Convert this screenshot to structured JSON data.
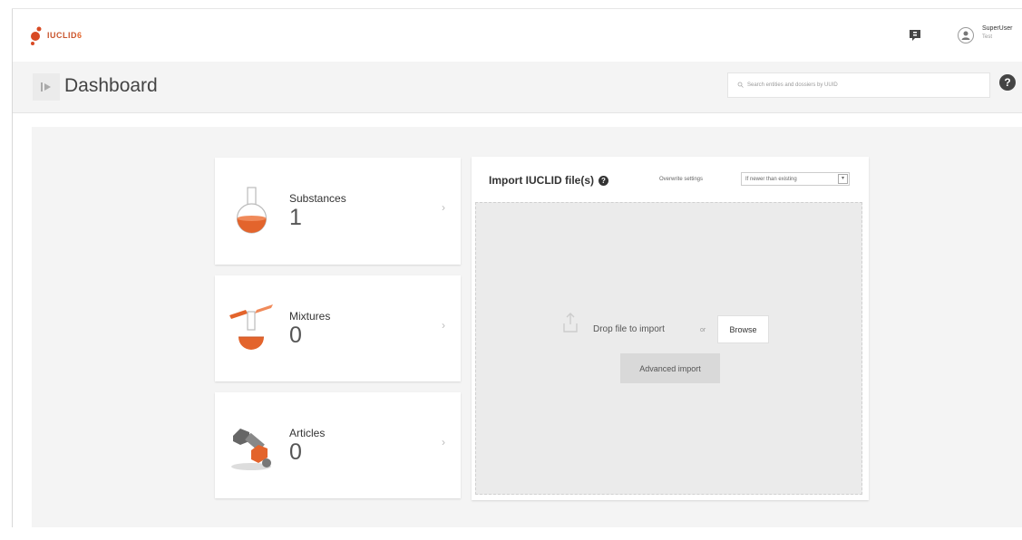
{
  "app": {
    "logo_text": "IUCLID",
    "logo_version": "6"
  },
  "header": {
    "user_name": "SuperUser",
    "user_role": "Test"
  },
  "page": {
    "title": "Dashboard",
    "search_placeholder": "Search entities and dossiers by UUID"
  },
  "cards": [
    {
      "label": "Substances",
      "count": "1"
    },
    {
      "label": "Mixtures",
      "count": "0"
    },
    {
      "label": "Articles",
      "count": "0"
    }
  ],
  "import": {
    "title": "Import IUCLID file(s)",
    "overwrite_label": "Overwrite settings",
    "overwrite_value": "If newer than existing",
    "drop_label": "Drop file to import",
    "or_label": "or",
    "browse_label": "Browse",
    "advanced_label": "Advanced import"
  },
  "colors": {
    "accent": "#e3642c",
    "background": "#f4f4f4"
  }
}
